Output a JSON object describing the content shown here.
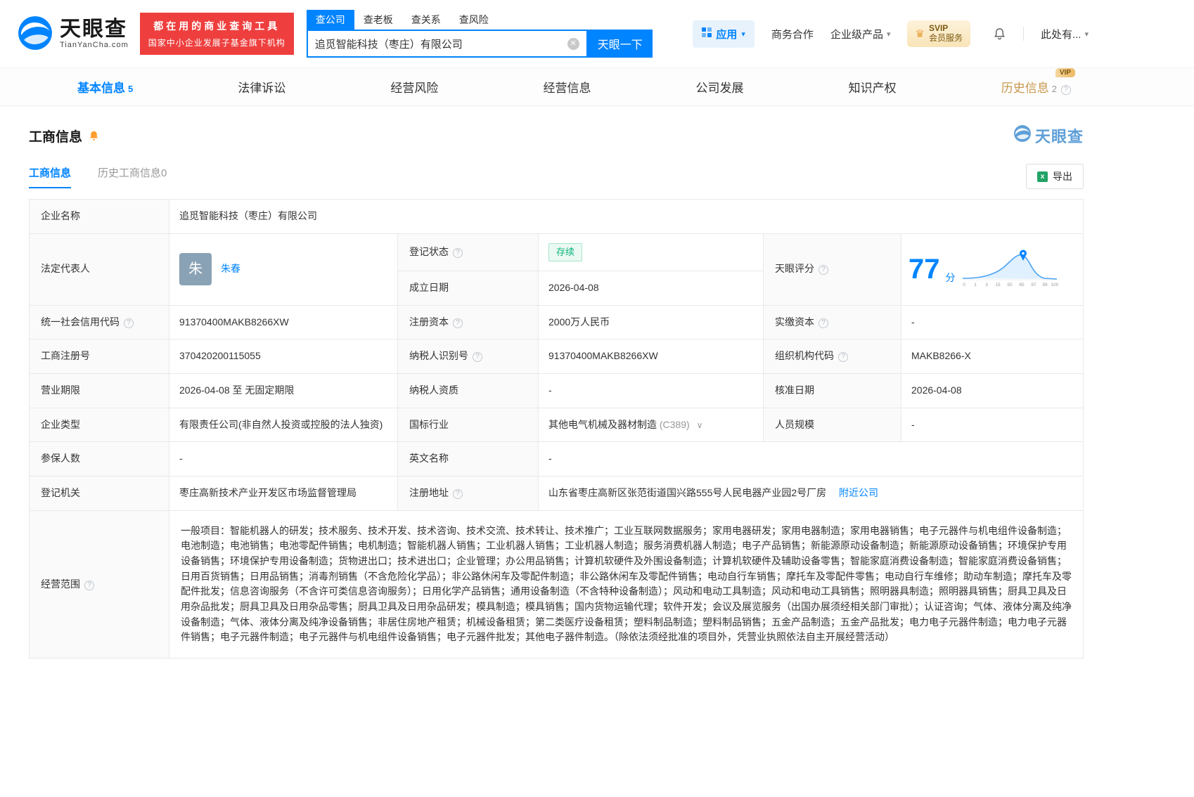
{
  "brand": {
    "name": "天眼查",
    "domain": "TianYanCha.com",
    "promo_line1": "都在用的商业查询工具",
    "promo_line2": "国家中小企业发展子基金旗下机构"
  },
  "search": {
    "tabs": [
      {
        "label": "查公司"
      },
      {
        "label": "查老板"
      },
      {
        "label": "查关系"
      },
      {
        "label": "查风险"
      }
    ],
    "value": "追觅智能科技（枣庄）有限公司",
    "button": "天眼一下"
  },
  "header_right": {
    "apps": "应用",
    "cooperation": "商务合作",
    "enterprise": "企业级产品",
    "svip": "SVIP",
    "svip_sub": "会员服务",
    "more": "此处有..."
  },
  "nav_tabs": [
    {
      "label": "基本信息",
      "count": "5"
    },
    {
      "label": "法律诉讼"
    },
    {
      "label": "经营风险"
    },
    {
      "label": "经营信息"
    },
    {
      "label": "公司发展"
    },
    {
      "label": "知识产权"
    },
    {
      "label": "历史信息",
      "count": "2",
      "badge": "VIP"
    }
  ],
  "section": {
    "title": "工商信息",
    "watermark": "天眼查",
    "tab_current": "工商信息",
    "tab_history": "历史工商信息0",
    "export": "导出"
  },
  "info": {
    "company_name_label": "企业名称",
    "company_name": "追觅智能科技（枣庄）有限公司",
    "legal_rep_label": "法定代表人",
    "legal_rep_initial": "朱",
    "legal_rep": "朱春",
    "reg_status_label": "登记状态",
    "reg_status": "存续",
    "establish_label": "成立日期",
    "establish_date": "2026-04-08",
    "score_label": "天眼评分",
    "score": "77",
    "score_unit": "分",
    "credit_code_label": "统一社会信用代码",
    "credit_code": "91370400MAKB8266XW",
    "reg_capital_label": "注册资本",
    "reg_capital": "2000万人民币",
    "paid_capital_label": "实缴资本",
    "paid_capital": "-",
    "reg_number_label": "工商注册号",
    "reg_number": "370420200115055",
    "taxpayer_id_label": "纳税人识别号",
    "taxpayer_id": "91370400MAKB8266XW",
    "org_code_label": "组织机构代码",
    "org_code": "MAKB8266-X",
    "business_term_label": "营业期限",
    "business_term": "2026-04-08 至 无固定期限",
    "taxpayer_quality_label": "纳税人资质",
    "taxpayer_quality": "-",
    "approval_date_label": "核准日期",
    "approval_date": "2026-04-08",
    "company_type_label": "企业类型",
    "company_type": "有限责任公司(非自然人投资或控股的法人独资)",
    "industry_label": "国标行业",
    "industry": "其他电气机械及器材制造",
    "industry_code": "(C389)",
    "staff_size_label": "人员规模",
    "staff_size": "-",
    "insured_label": "参保人数",
    "insured": "-",
    "english_name_label": "英文名称",
    "english_name": "-",
    "registry_label": "登记机关",
    "registry": "枣庄高新技术产业开发区市场监督管理局",
    "address_label": "注册地址",
    "address": "山东省枣庄高新区张范街道国兴路555号人民电器产业园2号厂房",
    "nearby_link": "附近公司",
    "scope_label": "经营范围",
    "scope": "一般项目：智能机器人的研发；技术服务、技术开发、技术咨询、技术交流、技术转让、技术推广；工业互联网数据服务；家用电器研发；家用电器制造；家用电器销售；电子元器件与机电组件设备制造；电池制造；电池销售；电池零配件销售；电机制造；智能机器人销售；工业机器人销售；工业机器人制造；服务消费机器人制造；电子产品销售；新能源原动设备制造；新能源原动设备销售；环境保护专用设备销售；环境保护专用设备制造；货物进出口；技术进出口；企业管理；办公用品销售；计算机软硬件及外围设备制造；计算机软硬件及辅助设备零售；智能家庭消费设备制造；智能家庭消费设备销售；日用百货销售；日用品销售；消毒剂销售（不含危险化学品）；非公路休闲车及零配件制造；非公路休闲车及零配件销售；电动自行车销售；摩托车及零配件零售；电动自行车维修；助动车制造；摩托车及零配件批发；信息咨询服务（不含许可类信息咨询服务）；日用化学产品销售；通用设备制造（不含特种设备制造）；风动和电动工具制造；风动和电动工具销售；照明器具制造；照明器具销售；厨具卫具及日用杂品批发；厨具卫具及日用杂品零售；厨具卫具及日用杂品研发；模具制造；模具销售；国内货物运输代理；软件开发；会议及展览服务（出国办展须经相关部门审批）；认证咨询；气体、液体分离及纯净设备制造；气体、液体分离及纯净设备销售；非居住房地产租赁；机械设备租赁；第二类医疗设备租赁；塑料制品制造；塑料制品销售；五金产品制造；五金产品批发；电力电子元器件制造；电力电子元器件销售；电子元器件制造；电子元器件与机电组件设备销售；电子元器件批发；其他电子器件制造。（除依法须经批准的项目外，凭营业执照依法自主开展经营活动）"
  },
  "score_chart": {
    "ticks": [
      "0",
      "1",
      "3",
      "15",
      "50",
      "85",
      "97",
      "99",
      "100"
    ]
  }
}
